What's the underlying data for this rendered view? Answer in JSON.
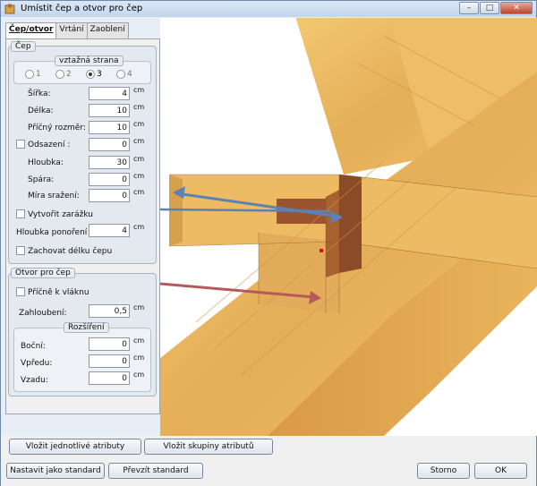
{
  "window": {
    "title": "Umístit čep a otvor pro čep"
  },
  "tabs": [
    "Čep/otvor",
    "Vrtání",
    "Zaoblení"
  ],
  "cep": {
    "group_title": "Čep",
    "ref_side_title": "vztažná strana",
    "ref_sides": [
      "1",
      "2",
      "3",
      "4"
    ],
    "ref_side_selected": "3",
    "rows": [
      {
        "label": "Šířka:",
        "value": "4",
        "unit": "cm"
      },
      {
        "label": "Délka:",
        "value": "10",
        "unit": "cm"
      },
      {
        "label": "Příčný rozměr:",
        "value": "10",
        "unit": "cm"
      },
      {
        "label": "Odsazení :",
        "value": "0",
        "unit": "cm"
      },
      {
        "label": "Hloubka:",
        "value": "30",
        "unit": "cm"
      },
      {
        "label": "Spára:",
        "value": "0",
        "unit": "cm"
      },
      {
        "label": "Míra sražení:",
        "value": "0",
        "unit": "cm"
      }
    ],
    "create_stop": "Vytvořit zarážku",
    "immersion_label": "Hloubka ponoření :",
    "immersion_value": "4",
    "immersion_unit": "cm",
    "keep_length": "Zachovat délku čepu"
  },
  "otvor": {
    "group_title": "Otvor pro čep",
    "cross_grain": "Příčně k vláknu",
    "deepening_label": "Zahloubení:",
    "deepening_value": "0,5",
    "deepening_unit": "cm",
    "expansion_title": "Rozšíření",
    "expansion_rows": [
      {
        "label": "Boční:",
        "value": "0",
        "unit": "cm"
      },
      {
        "label": "Vpředu:",
        "value": "0",
        "unit": "cm"
      },
      {
        "label": "Vzadu:",
        "value": "0",
        "unit": "cm"
      }
    ]
  },
  "buttons": {
    "insert_single": "Vložit jednotlivé atributy",
    "insert_group": "Vložit skupiny atributů",
    "set_standard": "Nastavit jako standard",
    "take_standard": "Převzít standard",
    "cancel": "Storno",
    "ok": "OK"
  },
  "colors": {
    "wood": "#e9b864",
    "wood_dark": "#c98a3a",
    "tenon": "#8b4a28",
    "arrow_blue": "#5b82b3",
    "arrow_red": "#b45a5a"
  }
}
